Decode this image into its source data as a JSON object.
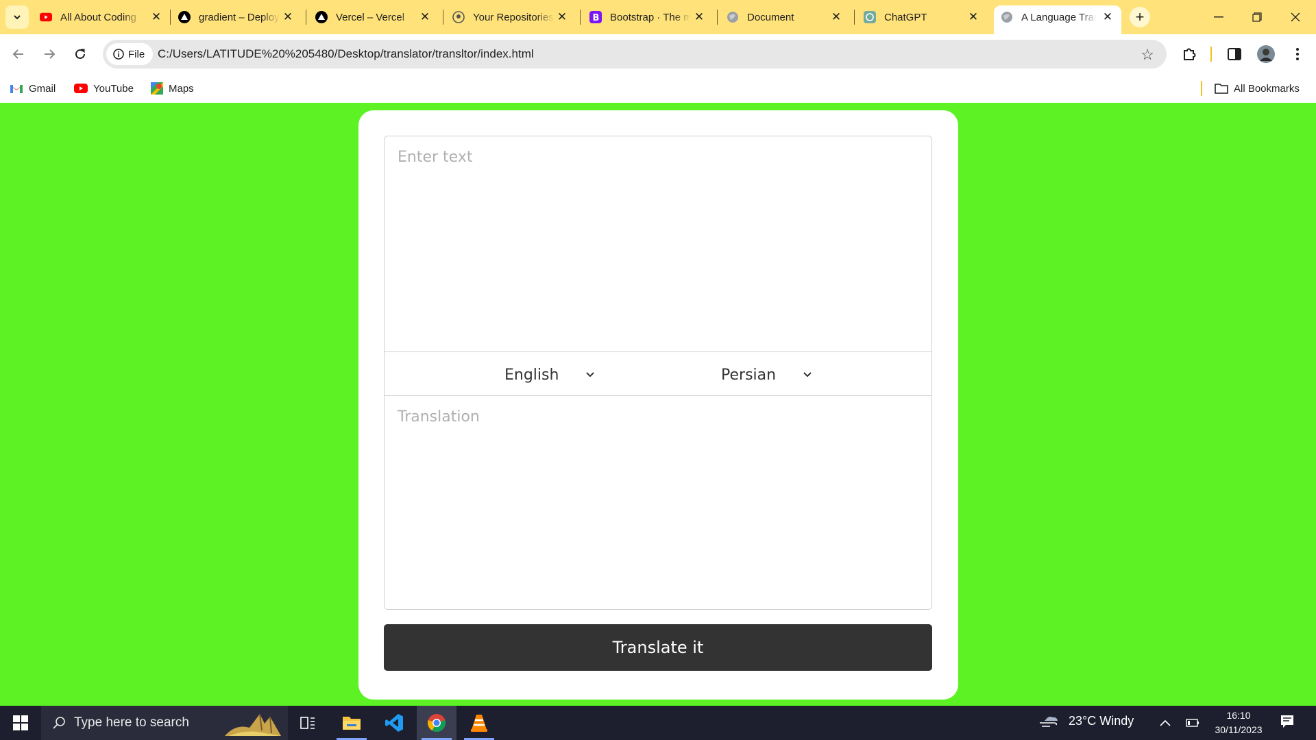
{
  "browser": {
    "tabs": [
      {
        "title": "All About Coding",
        "favicon": "youtube-icon"
      },
      {
        "title": "gradient – Deploy",
        "favicon": "vercel-icon"
      },
      {
        "title": "Vercel – Vercel",
        "favicon": "vercel-icon"
      },
      {
        "title": "Your Repositories",
        "favicon": "github-icon"
      },
      {
        "title": "Bootstrap · The most",
        "favicon": "bootstrap-icon"
      },
      {
        "title": "Document",
        "favicon": "globe-icon"
      },
      {
        "title": "ChatGPT",
        "favicon": "chatgpt-icon"
      },
      {
        "title": "A Language Translator",
        "favicon": "globe-icon",
        "active": true
      }
    ],
    "site_chip_label": "File",
    "url": "C:/Users/LATITUDE%20%205480/Desktop/translator/transltor/index.html",
    "bookmarks": [
      {
        "label": "Gmail",
        "icon": "gmail-icon"
      },
      {
        "label": "YouTube",
        "icon": "youtube-icon"
      },
      {
        "label": "Maps",
        "icon": "maps-icon"
      }
    ],
    "all_bookmarks_label": "All Bookmarks"
  },
  "page": {
    "background_color": "#5cf223",
    "from_placeholder": "Enter text",
    "to_placeholder": "Translation",
    "from_language": "English",
    "to_language": "Persian",
    "translate_button": "Translate it"
  },
  "taskbar": {
    "search_placeholder": "Type here to search",
    "weather": "23°C  Windy",
    "time": "16:10",
    "date": "30/11/2023"
  }
}
